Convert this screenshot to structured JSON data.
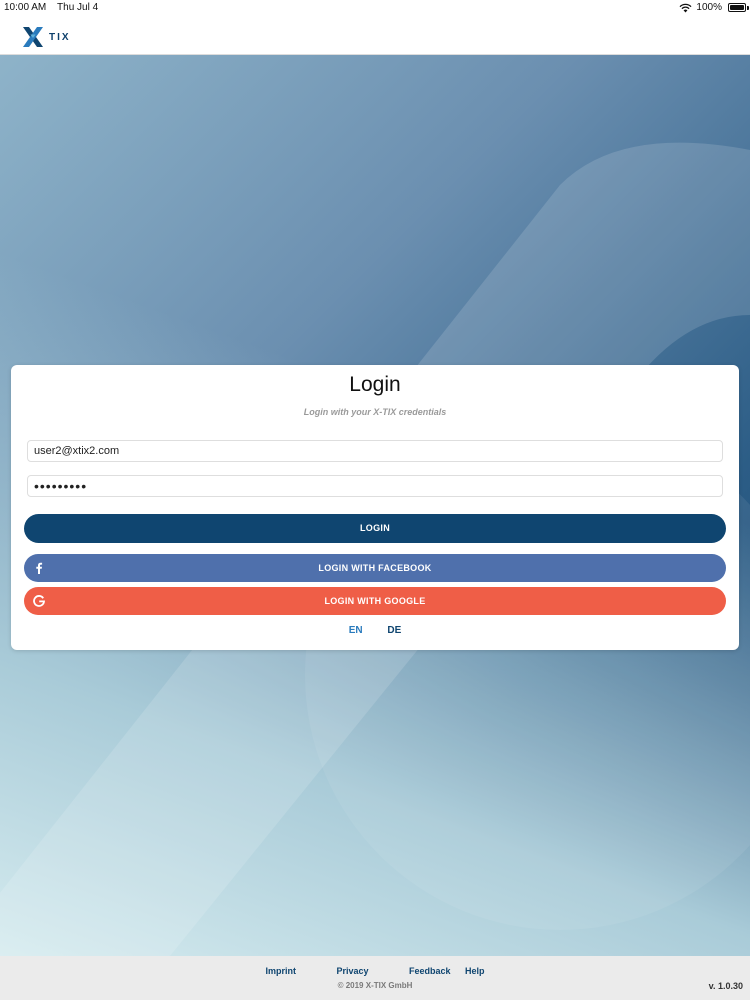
{
  "status_bar": {
    "time": "10:00 AM",
    "date": "Thu Jul 4",
    "battery": "100%",
    "battery_level": 1.0
  },
  "header": {
    "logo_text": "TIX"
  },
  "login": {
    "title": "Login",
    "subtitle": "Login with your X-TIX credentials",
    "email_value": "user2@xtix2.com",
    "password_value": "•••••••••",
    "login_button": "LOGIN",
    "facebook_button": "LOGIN WITH FACEBOOK",
    "google_button": "LOGIN WITH GOOGLE",
    "languages": [
      "EN",
      "DE"
    ],
    "active_language": "EN"
  },
  "footer": {
    "links": [
      "Imprint",
      "Privacy",
      "Feedback",
      "Help"
    ],
    "copyright": "© 2019 X-TIX GmbH",
    "version": "v. 1.0.30"
  },
  "colors": {
    "primary": "#0f4570",
    "facebook": "#4f70ac",
    "google": "#ef5e47",
    "lang_active": "#2a7bbd",
    "footer_bg": "#ebebeb"
  },
  "icons": {
    "facebook": "facebook-icon",
    "google": "google-icon",
    "wifi": "wifi-icon",
    "battery": "battery-icon",
    "logo": "x-logo-icon"
  }
}
